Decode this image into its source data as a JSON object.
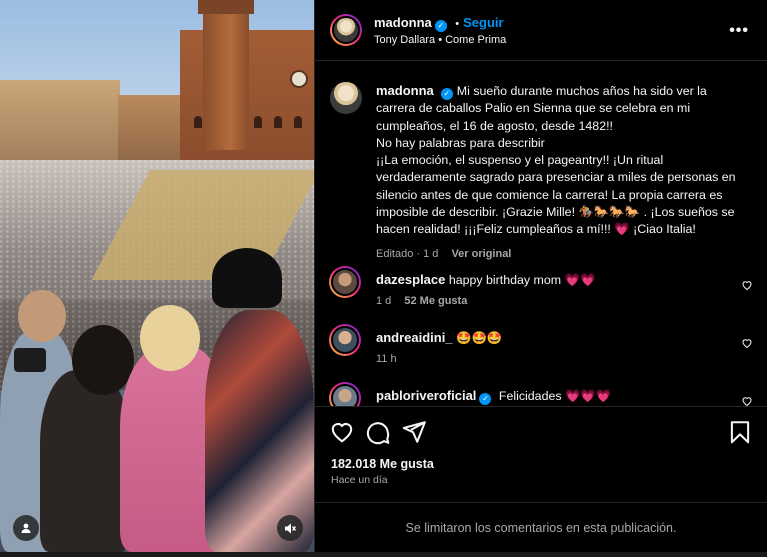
{
  "post": {
    "author": "madonna",
    "follow_label": "Seguir",
    "audio": "Tony Dallara • Come Prima",
    "more_label": "•••",
    "caption": {
      "author": "madonna",
      "line1": "Mi sueño durante muchos años ha sido ver la carrera de caballos Palio en Sienna que se celebra en mi cumpleaños, el 16 de agosto, desde 1482!!",
      "line2": "No hay palabras para describir",
      "line3": "¡¡La emoción, el suspenso y el pageantry!! ¡Un ritual verdaderamente sagrado para presenciar a miles de personas en silencio antes de que comience la carrera! La propia carrera es imposible de describir. ¡Grazie Mille! 🏇🐎🐎🐎 . ¡Los sueños se hacen realidad! ¡¡¡Feliz cumpleaños a mí!!! 💗 ¡Ciao Italia!",
      "edited": "Editado",
      "age": "1 d",
      "translate": "Ver original"
    },
    "comments": [
      {
        "user": "dazesplace",
        "text": "happy birthday mom 💗💗",
        "age": "1 d",
        "likes": "52 Me gusta",
        "verified": false
      },
      {
        "user": "andreaidini_",
        "text": "🤩🤩🤩",
        "age": "11 h",
        "likes": "",
        "verified": false
      },
      {
        "user": "pabloriveroficial",
        "text": "Felicidades 💗💗💗",
        "age": "",
        "likes": "",
        "verified": true
      }
    ],
    "likes": "182.018 Me gusta",
    "time": "Hace un día",
    "comments_disabled": "Se limitaron los comentarios en esta publicación."
  },
  "icons": [
    "heart-icon",
    "comment-icon",
    "share-icon",
    "bookmark-icon",
    "user-tag-icon",
    "mute-icon",
    "more-icon",
    "verified-icon"
  ],
  "colors": {
    "accent": "#0095f6",
    "background": "#000000",
    "secondary_text": "#a8a8a8",
    "divider": "#262626"
  }
}
